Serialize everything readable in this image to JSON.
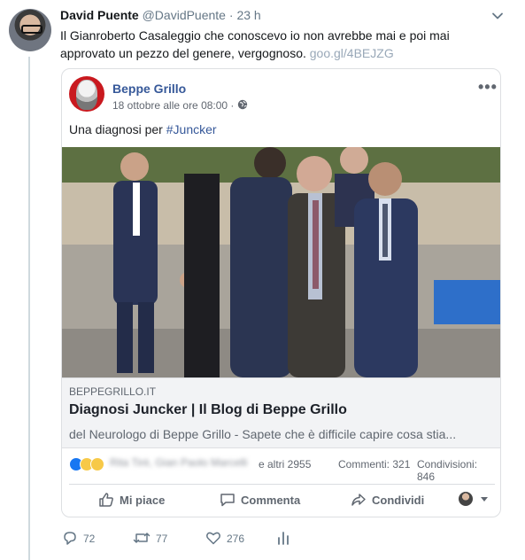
{
  "tweet": {
    "author_name": "David Puente",
    "author_handle": "@DavidPuente",
    "separator": "·",
    "time": "23 h",
    "text": "Il Gianroberto Casaleggio che conoscevo io non avrebbe mai e poi mai approvato un pezzo del genere, vergognoso.",
    "link": "goo.gl/4BEJZG",
    "actions": {
      "replies": "72",
      "retweets": "77",
      "likes": "276"
    }
  },
  "facebook_post": {
    "page_name": "Beppe Grillo",
    "date": "18 ottobre alle ore 08:00 ·",
    "more": "•••",
    "text": "Una diagnosi per",
    "hashtag": "#Juncker",
    "link_preview": {
      "domain": "BEPPEGRILLO.IT",
      "title": "Diagnosi Juncker | Il Blog di Beppe Grillo",
      "description": "del Neurologo di Beppe Grillo - Sapete che è difficile capire cosa stia..."
    },
    "reactions": {
      "names_blurred": "Rita Tirè, Gian Paolo Marcelli",
      "others": "e altri 2955",
      "comments": "Commenti: 321",
      "shares": "Condivisioni: 846"
    },
    "actions": {
      "like": "Mi piace",
      "comment": "Commenta",
      "share": "Condividi"
    }
  },
  "colors": {
    "facebook_blue": "#365899",
    "tweet_link": "#99a8b8",
    "muted": "#657786"
  }
}
